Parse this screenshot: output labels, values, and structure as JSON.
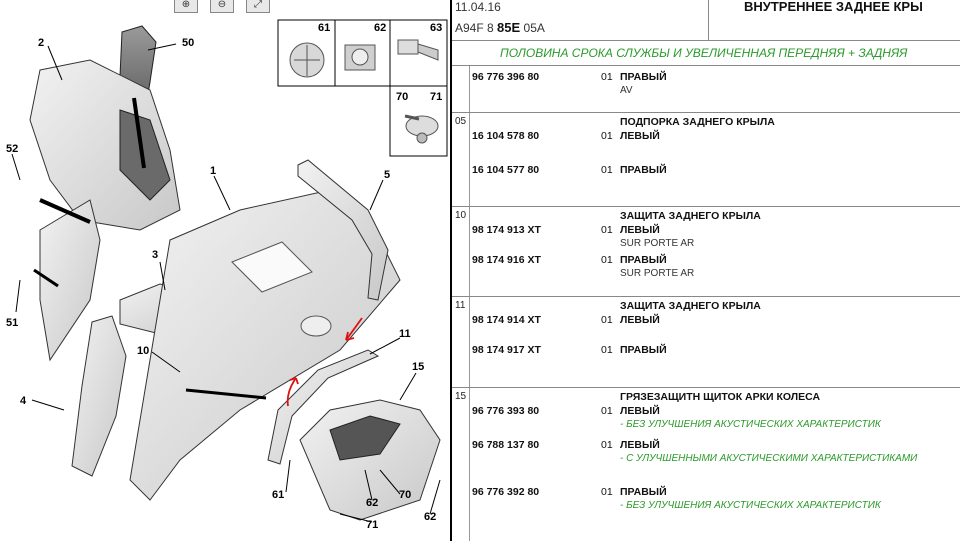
{
  "diagram": {
    "toolbar": {
      "zoom_in": "zoom-in-icon",
      "zoom_out": "zoom-out-icon",
      "zoom_fit": "zoom-fit-icon"
    },
    "callouts": [
      "1",
      "2",
      "3",
      "4",
      "5",
      "10",
      "11",
      "15",
      "50",
      "51",
      "52",
      "61",
      "62",
      "63",
      "70",
      "71"
    ],
    "callout_labels": {
      "c1": "1",
      "c2": "2",
      "c3": "3",
      "c4": "4",
      "c5": "5",
      "c10": "10",
      "c11": "11",
      "c15": "15",
      "c50": "50",
      "c51": "51",
      "c52": "52",
      "c61a": "61",
      "c62a": "62",
      "c63": "63",
      "c70a": "70",
      "c71a": "71",
      "c61b": "61",
      "c62b": "62",
      "c70b": "70",
      "c71b": "71",
      "c62c": "62"
    }
  },
  "header": {
    "date": "11.04.16",
    "code_prefix": "A94F 8",
    "code_bold": "85E",
    "code_suffix": "05A",
    "title": "ВНУТРЕННЕЕ ЗАДНЕЕ КРЫ",
    "subtitle": "ПОЛОВИНА СРОКА СЛУЖБЫ И УВЕЛИЧЕННАЯ ПЕРЕДНЯЯ + ЗАДНЯЯ"
  },
  "groups": [
    {
      "num": "",
      "title": "",
      "rows": [
        {
          "part": "96 776 396 80",
          "qty": "01",
          "desc": "ПРАВЫЙ",
          "note": "AV",
          "note_style": "plain"
        }
      ]
    },
    {
      "num": "05",
      "title": "ПОДПОРКА ЗАДНЕГО КРЫЛА",
      "rows": [
        {
          "part": "16 104 578 80",
          "qty": "01",
          "desc": "ЛЕВЫЙ",
          "note": "",
          "note_style": "plain"
        },
        {
          "part": "16 104 577 80",
          "qty": "01",
          "desc": "ПРАВЫЙ",
          "note": "",
          "note_style": "plain"
        }
      ]
    },
    {
      "num": "10",
      "title": "ЗАЩИТА ЗАДНЕГО КРЫЛА",
      "rows": [
        {
          "part": "98 174 913 XT",
          "qty": "01",
          "desc": "ЛЕВЫЙ",
          "note": "SUR PORTE AR",
          "note_style": "plain"
        },
        {
          "part": "98 174 916 XT",
          "qty": "01",
          "desc": "ПРАВЫЙ",
          "note": "SUR PORTE AR",
          "note_style": "plain"
        }
      ]
    },
    {
      "num": "11",
      "title": "ЗАЩИТА ЗАДНЕГО КРЫЛА",
      "rows": [
        {
          "part": "98 174 914 XT",
          "qty": "01",
          "desc": "ЛЕВЫЙ",
          "note": "",
          "note_style": "plain"
        },
        {
          "part": "98 174 917 XT",
          "qty": "01",
          "desc": "ПРАВЫЙ",
          "note": "",
          "note_style": "plain"
        }
      ]
    },
    {
      "num": "15",
      "title": "ГРЯЗЕЗАЩИТН ЩИТОК АРКИ КОЛЕСА",
      "rows": [
        {
          "part": "96 776 393 80",
          "qty": "01",
          "desc": "ЛЕВЫЙ",
          "note": "- БЕЗ УЛУЧШЕНИЯ АКУСТИЧЕСКИХ ХАРАКТЕРИСТИК",
          "note_style": "green"
        },
        {
          "part": "96 788 137 80",
          "qty": "01",
          "desc": "ЛЕВЫЙ",
          "note": "- С УЛУЧШЕННЫМИ АКУСТИЧЕСКИМИ ХАРАКТЕРИСТИКАМИ",
          "note_style": "green"
        },
        {
          "part": "96 776 392 80",
          "qty": "01",
          "desc": "ПРАВЫЙ",
          "note": "- БЕЗ УЛУЧШЕНИЯ АКУСТИЧЕСКИХ ХАРАКТЕРИСТИК",
          "note_style": "green"
        }
      ]
    }
  ],
  "colors": {
    "note_green": "#2a9a2a",
    "annotation_red": "#e01010"
  }
}
